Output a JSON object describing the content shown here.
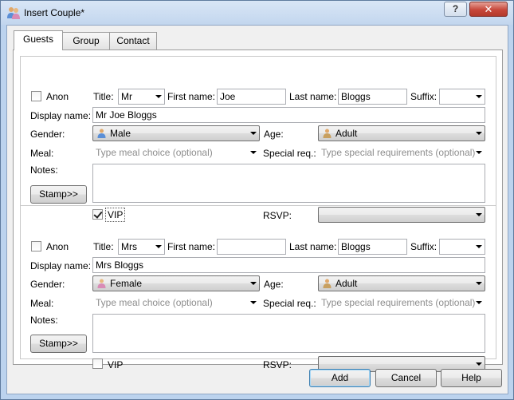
{
  "window": {
    "title": "Insert Couple*",
    "help_label": "?",
    "close_label": "✕"
  },
  "tabs": [
    {
      "label": "Guests",
      "active": true
    },
    {
      "label": "Group",
      "active": false
    },
    {
      "label": "Contact",
      "active": false
    }
  ],
  "labels": {
    "anon": "Anon",
    "title": "Title:",
    "first_name": "First name:",
    "last_name": "Last name:",
    "suffix": "Suffix:",
    "display_name": "Display name:",
    "gender": "Gender:",
    "age": "Age:",
    "meal": "Meal:",
    "special": "Special req.:",
    "notes": "Notes:",
    "stamp": "Stamp>>",
    "vip": "VIP",
    "rsvp": "RSVP:"
  },
  "guests": [
    {
      "anon": false,
      "title": "Mr",
      "first_name": "Joe",
      "last_name": "Bloggs",
      "suffix": "",
      "display_name": "Mr Joe Bloggs",
      "gender": "Male",
      "age": "Adult",
      "meal_placeholder": "Type meal choice (optional)",
      "special_placeholder": "Type special requirements (optional)",
      "notes": "",
      "vip": true,
      "rsvp": ""
    },
    {
      "anon": false,
      "title": "Mrs",
      "first_name": "",
      "last_name": "Bloggs",
      "suffix": "",
      "display_name": "Mrs  Bloggs",
      "gender": "Female",
      "age": "Adult",
      "meal_placeholder": "Type meal choice (optional)",
      "special_placeholder": "Type special requirements (optional)",
      "notes": "",
      "vip": false,
      "rsvp": ""
    }
  ],
  "buttons": {
    "add": "Add",
    "cancel": "Cancel",
    "help": "Help"
  },
  "colors": {
    "male_icon": "#5b8fd6",
    "female_icon": "#d98bb6",
    "adult_icon": "#c8a060"
  }
}
